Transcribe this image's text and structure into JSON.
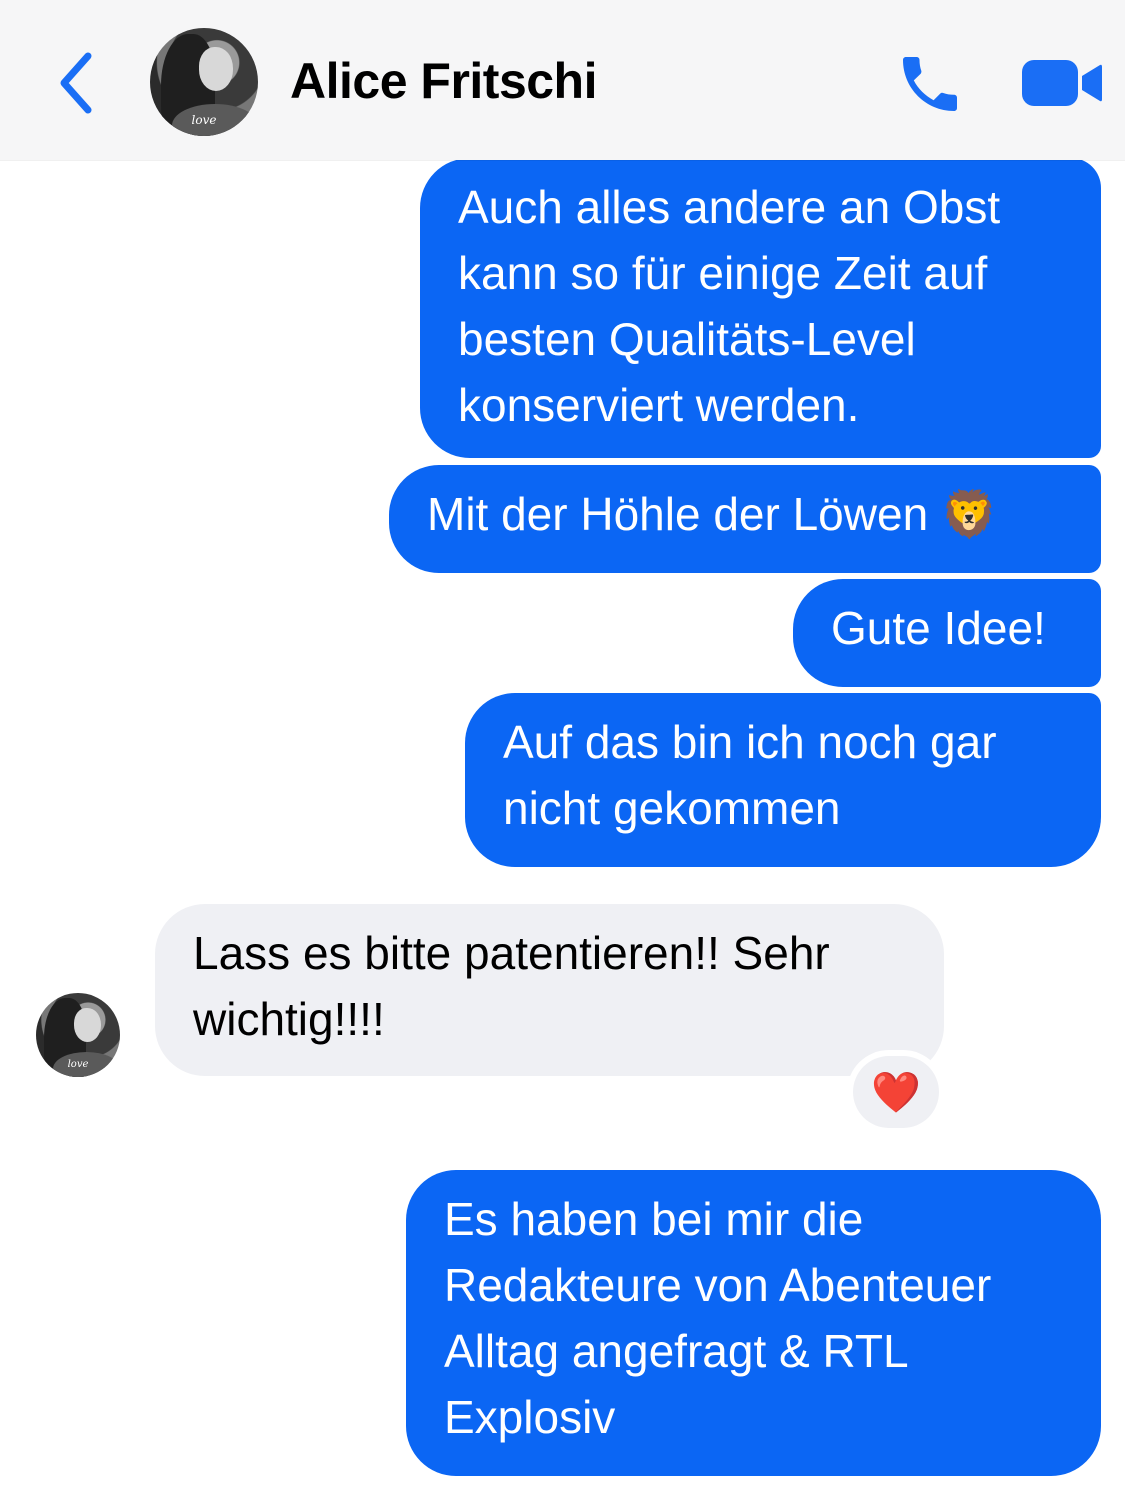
{
  "header": {
    "contact_name": "Alice Fritschi",
    "avatar_caption": "love"
  },
  "colors": {
    "accent": "#1a6ef5",
    "outgoing_bubble": "#0b66f4",
    "incoming_bubble": "#eff0f4",
    "reaction": "#e0102b"
  },
  "messages": [
    {
      "direction": "outgoing",
      "text": "Auch alles andere an Obst\nkann so für einige Zeit auf\nbesten Qualitäts-Level\nkonserviert werden."
    },
    {
      "direction": "outgoing",
      "text": "Mit der Höhle der Löwen 🦁"
    },
    {
      "direction": "outgoing",
      "text": "Gute Idee!"
    },
    {
      "direction": "outgoing",
      "text": "Auf das bin ich noch gar\nnicht gekommen"
    },
    {
      "direction": "incoming",
      "text": "Lass es bitte patentieren!! Sehr\nwichtig!!!!",
      "reaction": "❤️"
    },
    {
      "direction": "outgoing",
      "text": "Es haben bei mir die\nRedakteure von Abenteuer\nAlltag angefragt & RTL\nExplosiv"
    }
  ]
}
